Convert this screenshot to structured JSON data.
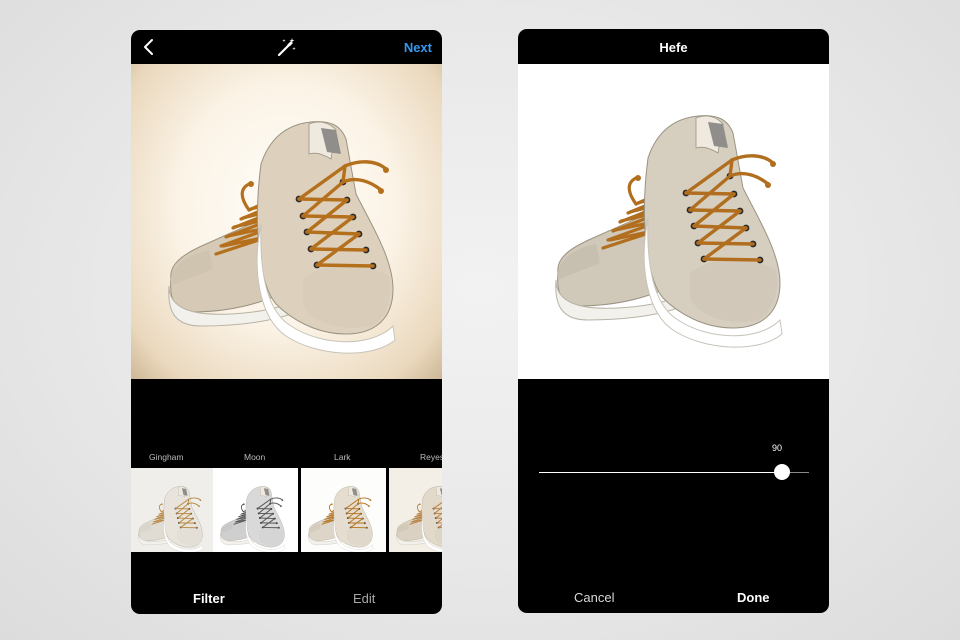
{
  "left_screen": {
    "next_label": "Next",
    "filters": [
      {
        "label": "Gingham",
        "style": "warm"
      },
      {
        "label": "Moon",
        "style": "mono"
      },
      {
        "label": "Lark",
        "style": "warm"
      },
      {
        "label": "Reyes",
        "style": "warm"
      }
    ],
    "tabs": {
      "filter": "Filter",
      "edit": "Edit"
    }
  },
  "right_screen": {
    "title": "Hefe",
    "slider": {
      "value_label": "90",
      "value": 90,
      "max": 100
    },
    "cancel_label": "Cancel",
    "done_label": "Done"
  },
  "colors": {
    "accent": "#3897f0",
    "background": "#000000",
    "lace": "#b7731f",
    "canvas": "#e6dfd1"
  },
  "icons": {
    "back": "chevron-left-icon",
    "magic": "magic-wand-icon"
  }
}
